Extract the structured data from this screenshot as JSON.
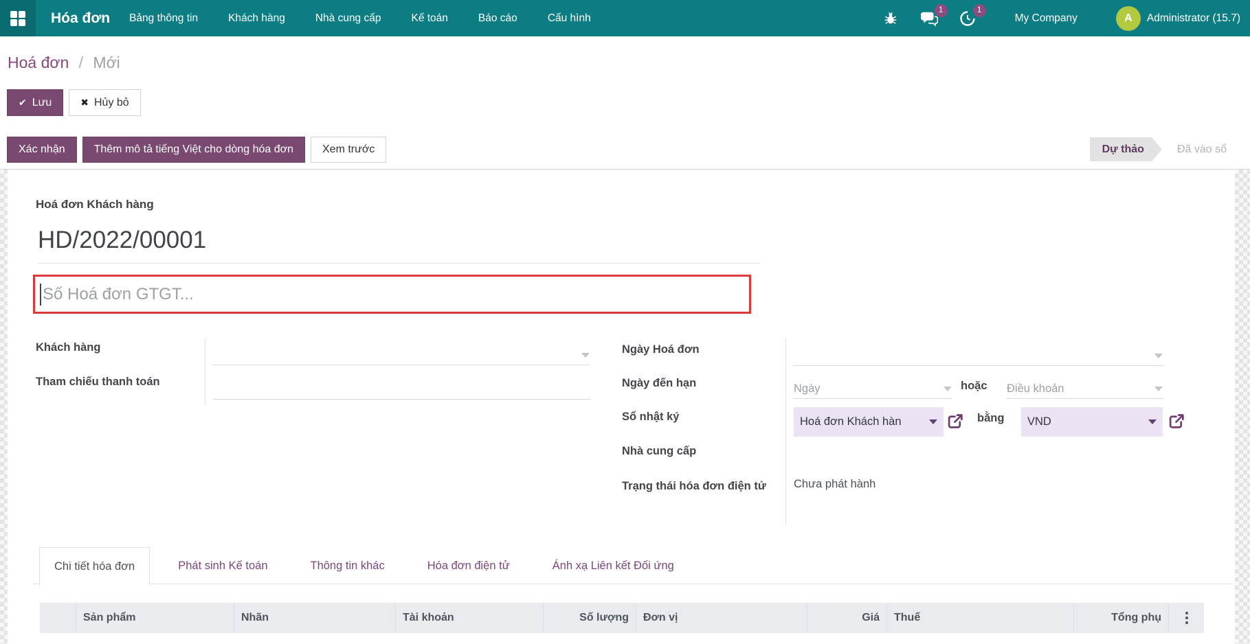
{
  "colors": {
    "navbar_teal": "#0c7d83",
    "apps_square_teal": "#0a6b71",
    "primary_purple": "#7a4971",
    "link_purple": "#87467c",
    "lavender_field_bg": "#ebe3f3",
    "alert_red_border": "#dc3a3a",
    "badge_purple": "#8a4d7f",
    "avatar_green": "#b3c940",
    "status_step_bg": "#e2e2e2"
  },
  "icons": {
    "apps": "2x2-grid",
    "debug": "bug",
    "messages": "chat-bubbles",
    "activities": "clock",
    "save_check": "✔",
    "discard_x": "✖",
    "dropdown_caret": "▾",
    "external_link": "↗",
    "optional_columns": "⋮"
  },
  "navbar": {
    "brand": "Hóa đơn",
    "menu_items": [
      "Bảng thông tin",
      "Khách hàng",
      "Nhà cung cấp",
      "Kế toán",
      "Báo cáo",
      "Cấu hình"
    ],
    "message_badge": "1",
    "activity_badge": "1",
    "company": "My Company",
    "avatar_letter": "A",
    "user": "Administrator (15.7)"
  },
  "breadcrumb": {
    "parent": "Hoá đơn",
    "separator": "/",
    "current": "Mới"
  },
  "actions": {
    "save": "Lưu",
    "discard": "Hủy bỏ"
  },
  "statusbar": {
    "confirm": "Xác nhận",
    "add_vi_description": "Thêm mô tả tiếng Việt cho dòng hóa đơn",
    "preview": "Xem trước",
    "state_draft": "Dự thảo",
    "state_posted": "Đã vào sổ"
  },
  "form": {
    "doc_type_label": "Hoá đơn Khách hàng",
    "doc_name": "HD/2022/00001",
    "vat_invoice_placeholder": "Số Hoá đơn GTGT...",
    "customer_label": "Khách hàng",
    "payment_ref_label": "Tham chiếu thanh toán",
    "invoice_date_label": "Ngày Hoá đơn",
    "due_date_label": "Ngày đến hạn",
    "due_date_placeholder": "Ngày",
    "or_text": "hoặc",
    "terms_placeholder": "Điều khoản",
    "journal_label": "Sổ nhật ký",
    "journal_value": "Hoá đơn Khách hàn",
    "in_currency_text": "bằng",
    "currency_value": "VND",
    "vendor_label": "Nhà cung cấp",
    "einvoice_status_label": "Trạng thái hóa đơn điện tử",
    "einvoice_status_value": "Chưa phát hành"
  },
  "tabs": [
    "Chi tiết hóa đơn",
    "Phát sinh Kế toán",
    "Thông tin khác",
    "Hóa đơn điện tử",
    "Ánh xạ Liên kết Đối ứng"
  ],
  "lines_table": {
    "columns": [
      "Sản phẩm",
      "Nhãn",
      "Tài khoản",
      "Số lượng",
      "Đơn vị",
      "Giá",
      "Thuế",
      "Tổng phụ"
    ]
  }
}
